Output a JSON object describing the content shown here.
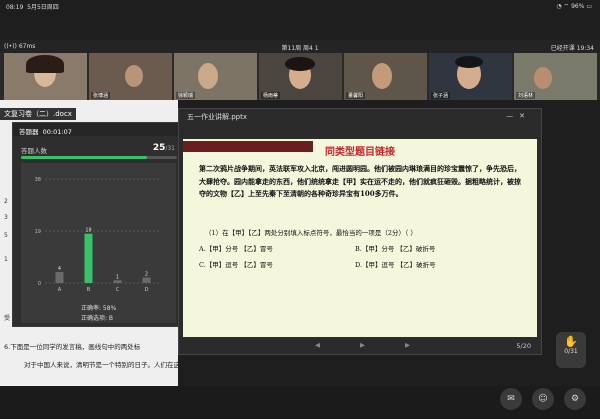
{
  "status_bar": {
    "time": "08:19",
    "date": "5月5日周四",
    "battery": "96%"
  },
  "meeting": {
    "signal": "67ms",
    "title": "第11周 周4 1",
    "elapsed": "已经开课 19:34"
  },
  "videos": [
    {
      "name": ""
    },
    {
      "name": "张博涵"
    },
    {
      "name": "徐颖瑞"
    },
    {
      "name": "杨雨蒂"
    },
    {
      "name": "董馨阳"
    },
    {
      "name": "张子涵"
    },
    {
      "name": "刘语林"
    }
  ],
  "doc": {
    "title": "文复习卷（二）.docx",
    "side_chars": [
      "2",
      "3",
      "5",
      "1",
      "受"
    ],
    "question6": "6.下面是一位同学的发言稿，画线句中的两处标",
    "question6_line2": "对于中国人来说，清明节是一个特别的日子。人们在这一天表达怀念之情"
  },
  "stats": {
    "header_label": "答题器",
    "timer": "00:01:07",
    "count_label": "答题人数",
    "count": "25",
    "total": "/31",
    "progress": 0.806,
    "accuracy_label": "正确率: 58%",
    "correct_label": "正确选项: B"
  },
  "chart_data": {
    "type": "bar",
    "categories": [
      "A",
      "B",
      "C",
      "D"
    ],
    "values": [
      4,
      18,
      1,
      2
    ],
    "yticks": [
      0,
      19,
      38
    ],
    "ylim": [
      0,
      38
    ],
    "highlight": "B",
    "colors": {
      "normal": "#6a6a6a",
      "highlight": "#37c26b"
    }
  },
  "ppt": {
    "title": "五一作业讲解.pptx",
    "slide_title": "同类型题目链接",
    "paragraph": "第二次鸦片战争期间，英法联军攻入北京，闯进圆明园。他们被园内琳琅满目的珍宝震惊了，争先恐后，大肆抢夺。园内能拿走的东西，他们统统拿走【甲】实在运不走的，他们就疯狂砸毁。据粗略统计，被掠夺的文物【乙】上至先秦下至清朝的各种奇珍异宝有100多万件。",
    "question": "（1）在【甲】【乙】两处分别填入标点符号，最恰当的一项是（2分）（    ）",
    "options": [
      {
        "label": "A.【甲】分号    【乙】冒号"
      },
      {
        "label": "B.【甲】分号    【乙】破折号"
      },
      {
        "label": "C.【甲】逗号    【乙】冒号"
      },
      {
        "label": "D.【甲】逗号    【乙】破折号"
      }
    ],
    "page": "5/20"
  },
  "side_widget": {
    "count": "0/31"
  }
}
